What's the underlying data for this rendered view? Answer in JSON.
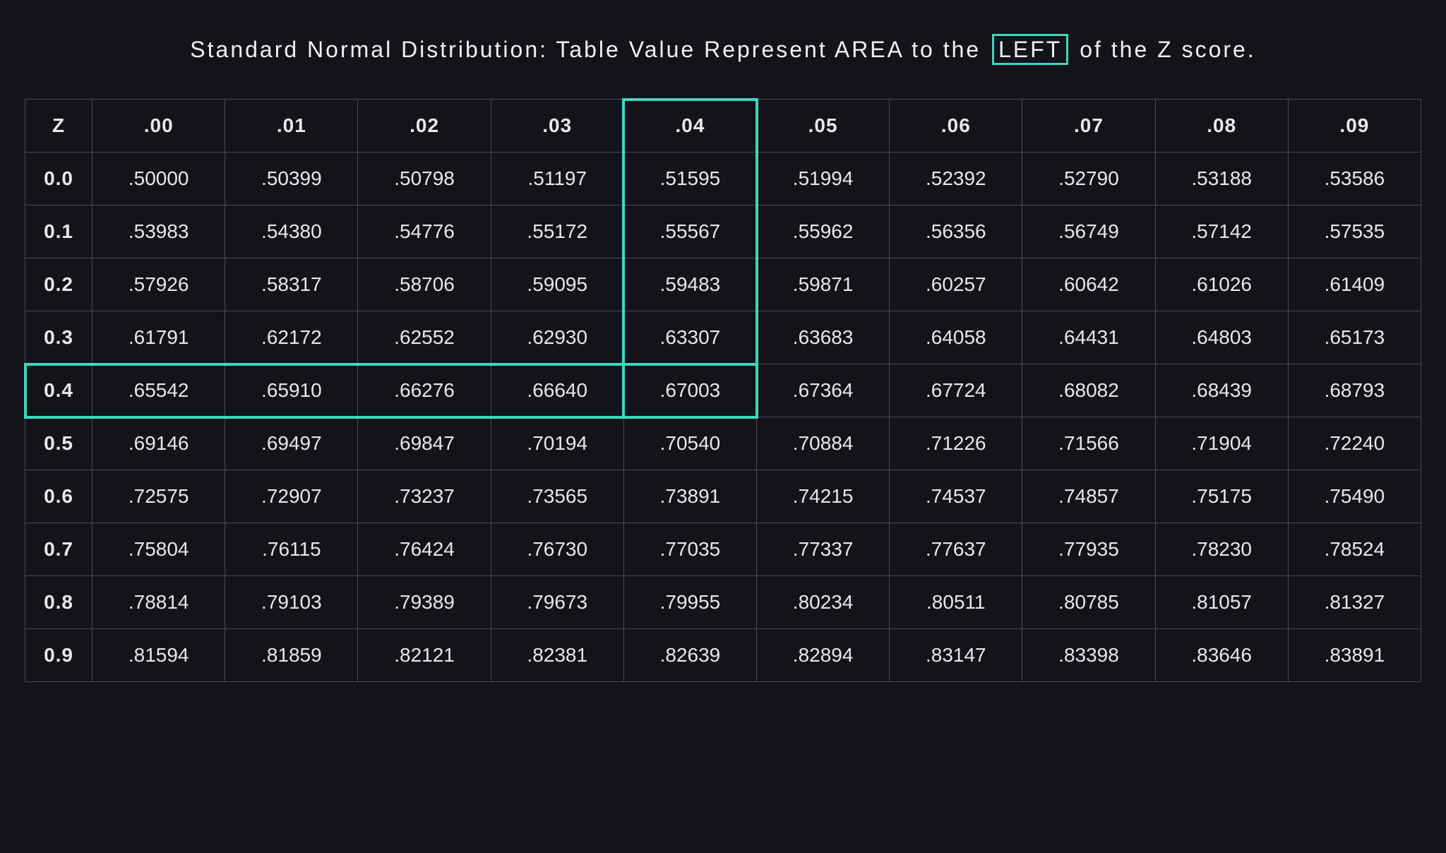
{
  "title_parts": {
    "pre": "Standard Normal Distribution: Table Value Represent AREA to the",
    "boxed": "LEFT",
    "post": "of the Z score."
  },
  "highlight": {
    "row_index": 4,
    "col_index": 4,
    "row_label": "0.4",
    "col_label": ".04",
    "value": ".67003"
  },
  "chart_data": {
    "type": "table",
    "title": "Standard Normal Distribution: Table Value Represent AREA to the LEFT of the Z score.",
    "corner_label": "Z",
    "col_headers": [
      ".00",
      ".01",
      ".02",
      ".03",
      ".04",
      ".05",
      ".06",
      ".07",
      ".08",
      ".09"
    ],
    "row_headers": [
      "0.0",
      "0.1",
      "0.2",
      "0.3",
      "0.4",
      "0.5",
      "0.6",
      "0.7",
      "0.8",
      "0.9"
    ],
    "values": [
      [
        ".50000",
        ".50399",
        ".50798",
        ".51197",
        ".51595",
        ".51994",
        ".52392",
        ".52790",
        ".53188",
        ".53586"
      ],
      [
        ".53983",
        ".54380",
        ".54776",
        ".55172",
        ".55567",
        ".55962",
        ".56356",
        ".56749",
        ".57142",
        ".57535"
      ],
      [
        ".57926",
        ".58317",
        ".58706",
        ".59095",
        ".59483",
        ".59871",
        ".60257",
        ".60642",
        ".61026",
        ".61409"
      ],
      [
        ".61791",
        ".62172",
        ".62552",
        ".62930",
        ".63307",
        ".63683",
        ".64058",
        ".64431",
        ".64803",
        ".65173"
      ],
      [
        ".65542",
        ".65910",
        ".66276",
        ".66640",
        ".67003",
        ".67364",
        ".67724",
        ".68082",
        ".68439",
        ".68793"
      ],
      [
        ".69146",
        ".69497",
        ".69847",
        ".70194",
        ".70540",
        ".70884",
        ".71226",
        ".71566",
        ".71904",
        ".72240"
      ],
      [
        ".72575",
        ".72907",
        ".73237",
        ".73565",
        ".73891",
        ".74215",
        ".74537",
        ".74857",
        ".75175",
        ".75490"
      ],
      [
        ".75804",
        ".76115",
        ".76424",
        ".76730",
        ".77035",
        ".77337",
        ".77637",
        ".77935",
        ".78230",
        ".78524"
      ],
      [
        ".78814",
        ".79103",
        ".79389",
        ".79673",
        ".79955",
        ".80234",
        ".80511",
        ".80785",
        ".81057",
        ".81327"
      ],
      [
        ".81594",
        ".81859",
        ".82121",
        ".82381",
        ".82639",
        ".82894",
        ".83147",
        ".83398",
        ".83646",
        ".83891"
      ]
    ]
  }
}
